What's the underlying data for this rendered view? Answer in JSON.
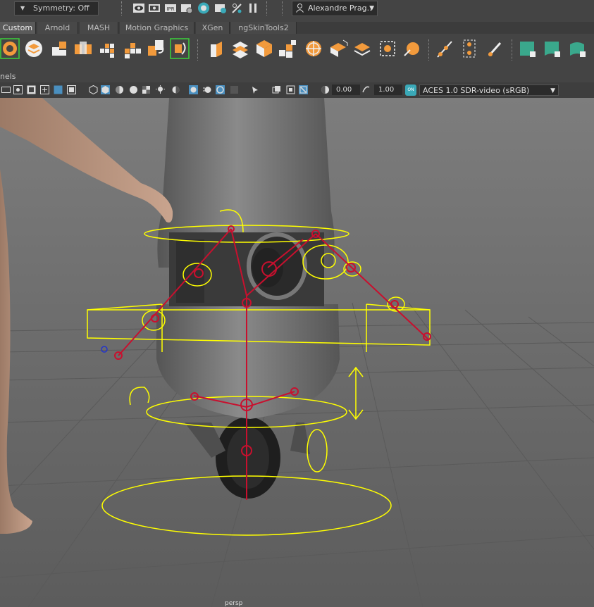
{
  "status_line": {
    "symmetry_label": "Symmetry: Off",
    "user_label": "Alexandre Prag..",
    "render_icons": [
      "show-icon",
      "render-icon",
      "ipr-icon",
      "render-settings-icon",
      "hypershade-icon",
      "render-view-icon",
      "snap-icon",
      "pause-icon"
    ],
    "ipr_text": "IPR"
  },
  "shelf_tabs": [
    "Custom",
    "Arnold",
    "MASH",
    "Motion Graphics",
    "XGen",
    "ngSkinTools2"
  ],
  "active_tab": "Custom",
  "panels_label": "nels",
  "viewport_toolbar": {
    "exposure_value": "0.00",
    "gamma_value": "1.00",
    "ocio_badge": "ON",
    "color_space": "ACES 1.0 SDR-video (sRGB)"
  },
  "camera_label": "persp",
  "colors": {
    "ui_bg": "#444444",
    "viewport_bg": "#6b6b6b",
    "grid": "#5b5b5b",
    "controls": "#ffff00",
    "joints": "#c8102e",
    "accent_orange": "#f29a3c"
  }
}
